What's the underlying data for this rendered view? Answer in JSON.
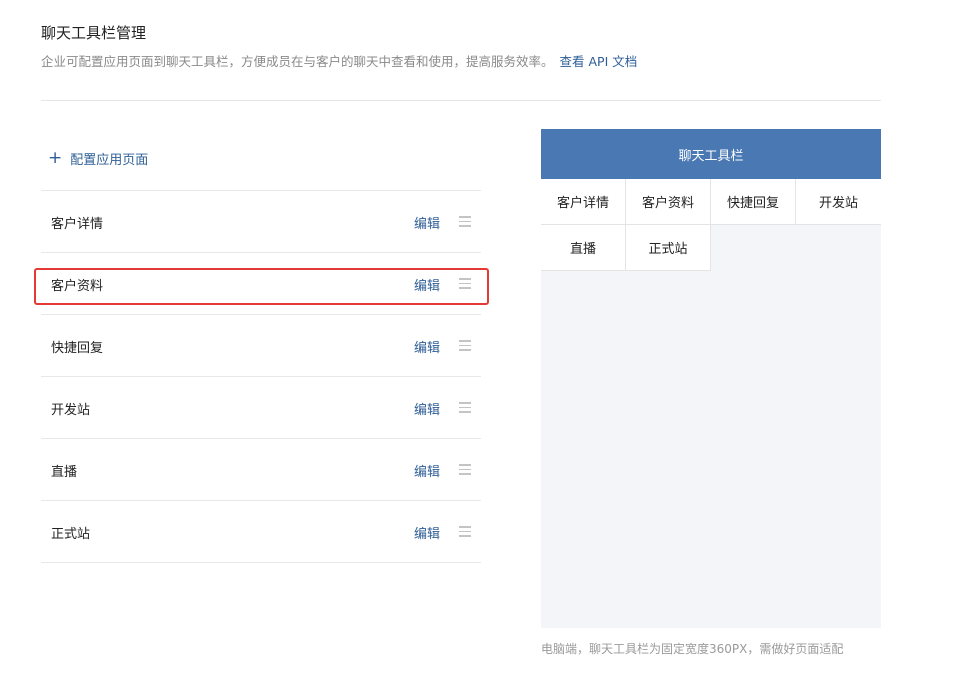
{
  "header": {
    "title": "聊天工具栏管理",
    "description": "企业可配置应用页面到聊天工具栏，方便成员在与客户的聊天中查看和使用，提高服务效率。",
    "api_link": "查看 API 文档"
  },
  "add_button": {
    "icon": "plus-icon",
    "label": "配置应用页面"
  },
  "list": {
    "edit_label": "编辑",
    "items": [
      {
        "label": "客户详情"
      },
      {
        "label": "客户资料"
      },
      {
        "label": "快捷回复"
      },
      {
        "label": "开发站"
      },
      {
        "label": "直播"
      },
      {
        "label": "正式站"
      }
    ]
  },
  "preview": {
    "title": "聊天工具栏",
    "tabs": [
      "客户详情",
      "客户资料",
      "快捷回复",
      "开发站",
      "直播",
      "正式站"
    ]
  },
  "footer_note": "电脑端，聊天工具栏为固定宽度360PX，需做好页面适配",
  "colors": {
    "accent": "#4a78b3",
    "link": "#2e5e96",
    "highlight": "#e53935"
  }
}
